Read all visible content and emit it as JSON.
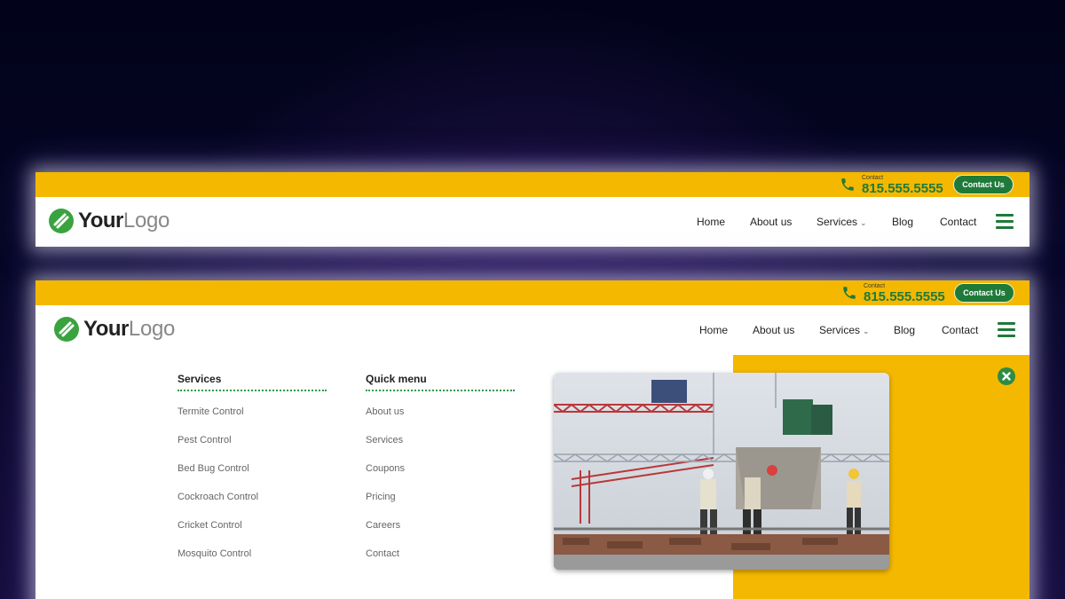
{
  "variants": {
    "header_a": {
      "contact_label": "Contact",
      "phone": "815.555.5555",
      "contact_button": "Contact Us",
      "logo_bold": "Your",
      "logo_light": "Logo",
      "nav": {
        "home": "Home",
        "about": "About us",
        "services": "Services",
        "blog": "Blog",
        "contact": "Contact"
      }
    },
    "header_b": {
      "contact_label": "Contact",
      "phone": "815.555.5555",
      "contact_button": "Contact Us",
      "logo_bold": "Your",
      "logo_light": "Logo",
      "nav": {
        "home": "Home",
        "about": "About us",
        "services": "Services",
        "blog": "Blog",
        "contact": "Contact"
      }
    }
  },
  "mega_menu": {
    "services_heading": "Services",
    "services_items": [
      "Termite Control",
      "Pest Control",
      "Bed Bug Control",
      "Cockroach Control",
      "Cricket Control",
      "Mosquito Control"
    ],
    "quick_heading": "Quick menu",
    "quick_items": [
      "About us",
      "Services",
      "Coupons",
      "Pricing",
      "Careers",
      "Contact"
    ]
  },
  "icons": {
    "phone": "phone-icon",
    "logo": "leaf-logo-icon",
    "menu": "hamburger-icon",
    "close": "close-icon",
    "dropdown": "chevron-down-icon"
  },
  "colors": {
    "topbar": "#f4b800",
    "brand_green": "#1f7a3a",
    "panel_bg": "#ffffff"
  }
}
